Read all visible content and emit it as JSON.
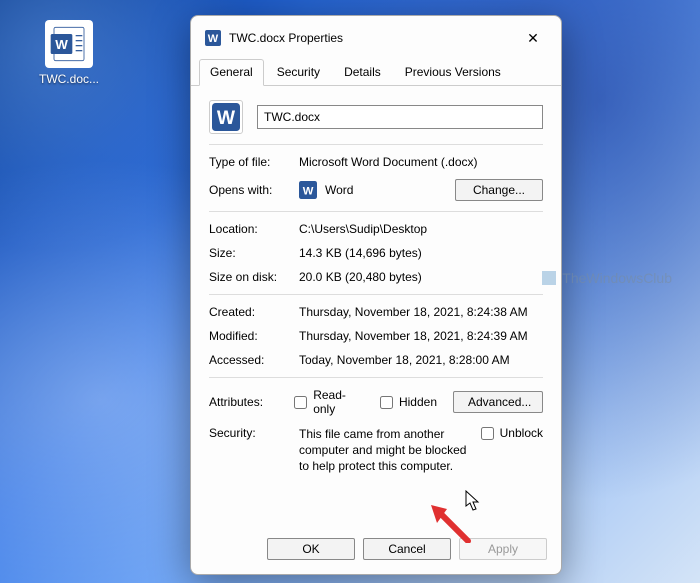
{
  "desktop": {
    "file_label": "TWC.doc..."
  },
  "dialog": {
    "title": "TWC.docx Properties",
    "tabs": [
      "General",
      "Security",
      "Details",
      "Previous Versions"
    ],
    "filename": "TWC.docx",
    "rows": {
      "type_label": "Type of file:",
      "type_value": "Microsoft Word Document (.docx)",
      "opens_label": "Opens with:",
      "opens_value": "Word",
      "change_btn": "Change...",
      "location_label": "Location:",
      "location_value": "C:\\Users\\Sudip\\Desktop",
      "size_label": "Size:",
      "size_value": "14.3 KB (14,696 bytes)",
      "disk_label": "Size on disk:",
      "disk_value": "20.0 KB (20,480 bytes)",
      "created_label": "Created:",
      "created_value": "Thursday, November 18, 2021, 8:24:38 AM",
      "modified_label": "Modified:",
      "modified_value": "Thursday, November 18, 2021, 8:24:39 AM",
      "accessed_label": "Accessed:",
      "accessed_value": "Today, November 18, 2021, 8:28:00 AM",
      "attributes_label": "Attributes:",
      "readonly_label": "Read-only",
      "hidden_label": "Hidden",
      "advanced_btn": "Advanced...",
      "security_label": "Security:",
      "security_text": "This file came from another computer and might be blocked to help protect this computer.",
      "unblock_label": "Unblock"
    },
    "buttons": {
      "ok": "OK",
      "cancel": "Cancel",
      "apply": "Apply"
    }
  },
  "watermark": "TheWindowsClub"
}
